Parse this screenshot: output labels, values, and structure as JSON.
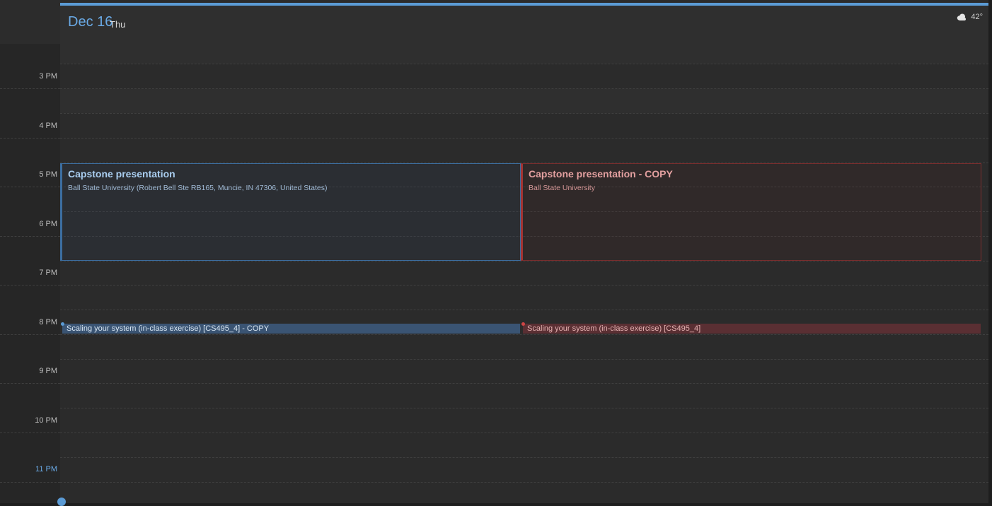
{
  "header": {
    "date_num": "Dec 16",
    "day_of_week": "Thu",
    "weather": {
      "icon": "cloud-icon",
      "temperature": "42°"
    }
  },
  "time_labels": {
    "t3": "3 PM",
    "t4": "4 PM",
    "t5": "5 PM",
    "t6": "6 PM",
    "t7": "7 PM",
    "t8": "8 PM",
    "t9": "9 PM",
    "t10": "10 PM",
    "t11": "11 PM"
  },
  "events": {
    "capstone": {
      "title": "Capstone presentation",
      "location": "Ball State University (Robert Bell Ste RB165, Muncie, IN 47306, United States)"
    },
    "capstone_copy": {
      "title": "Capstone presentation - COPY",
      "location": "Ball State University"
    },
    "scaling_copy": {
      "title": "Scaling your system (in-class exercise) [CS495_4] - COPY"
    },
    "scaling": {
      "title": "Scaling your system (in-class exercise) [CS495_4]"
    }
  },
  "colors": {
    "accent": "#5b9bd5",
    "event_blue": "#3c6ea0",
    "event_red": "#a23434"
  }
}
